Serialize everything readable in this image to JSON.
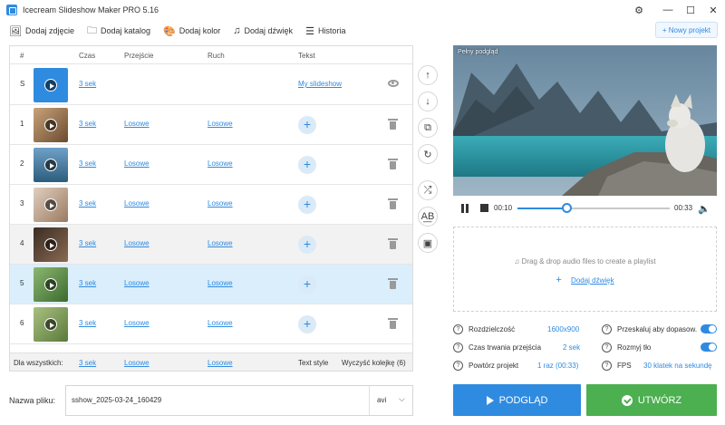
{
  "window": {
    "title": "Icecream Slideshow Maker PRO 5.16",
    "controls": {
      "settings": "⚙",
      "minimize": "—",
      "maximize": "☐",
      "close": "✕"
    }
  },
  "toolbar": {
    "add_photo": "Dodaj zdjęcie",
    "add_folder": "Dodaj katalog",
    "add_color": "Dodaj kolor",
    "add_sound": "Dodaj dźwięk",
    "history": "Historia",
    "new_project": "+ Nowy projekt"
  },
  "list": {
    "headers": {
      "num": "#",
      "time": "Czas",
      "transition": "Przejście",
      "motion": "Ruch",
      "text": "Tekst"
    },
    "rows": [
      {
        "num": "S",
        "time": "3 sek",
        "transition": "",
        "motion": "",
        "text": "My slideshow",
        "thumb": "#2f8be0"
      },
      {
        "num": "1",
        "time": "3 sek",
        "transition": "Losowe",
        "motion": "Losowe",
        "text": "+",
        "thumb": "#9a7a5a"
      },
      {
        "num": "2",
        "time": "3 sek",
        "transition": "Losowe",
        "motion": "Losowe",
        "text": "+",
        "thumb": "#3d7ba8"
      },
      {
        "num": "3",
        "time": "3 sek",
        "transition": "Losowe",
        "motion": "Losowe",
        "text": "+",
        "thumb": "#b89a80"
      },
      {
        "num": "4",
        "time": "3 sek",
        "transition": "Losowe",
        "motion": "Losowe",
        "text": "+",
        "thumb": "#5b4636"
      },
      {
        "num": "5",
        "time": "3 sek",
        "transition": "Losowe",
        "motion": "Losowe",
        "text": "+",
        "thumb": "#5a8a4a"
      },
      {
        "num": "6",
        "time": "3 sek",
        "transition": "Losowe",
        "motion": "Losowe",
        "text": "+",
        "thumb": "#7a9a5a"
      }
    ],
    "footer": {
      "for_all": "Dla wszystkich:",
      "time": "3 sek",
      "transition": "Losowe",
      "motion": "Losowe",
      "text_style": "Text style",
      "clear_queue": "Wyczyść kolejkę (6)"
    }
  },
  "side_tools": [
    "↑",
    "↓",
    "⧉",
    "↻",
    "⤮",
    "A͟B",
    "▣"
  ],
  "preview": {
    "label": "Pełny podgląd",
    "time_current": "00:10",
    "time_total": "00:33",
    "progress": 0.33
  },
  "audio": {
    "hint": "Drag & drop audio files to create a playlist",
    "add_label": "Dodaj dźwięk"
  },
  "settings": {
    "resolution_label": "Rozdzielczość",
    "resolution_value": "1600x900",
    "transition_label": "Czas trwania przejścia",
    "transition_value": "2 sek",
    "repeat_label": "Powtórz projekt",
    "repeat_value": "1 raz (00:33)",
    "rescale_label": "Przeskaluj aby dopasow.",
    "blur_label": "Rozmyj tło",
    "fps_label": "FPS",
    "fps_value": "30 klatek na sekundę"
  },
  "output": {
    "filename_label": "Nazwa pliku:",
    "filename": "sshow_2025-03-24_160429",
    "format": "avi"
  },
  "buttons": {
    "preview": "PODGLĄD",
    "create": "UTWÓRZ"
  }
}
